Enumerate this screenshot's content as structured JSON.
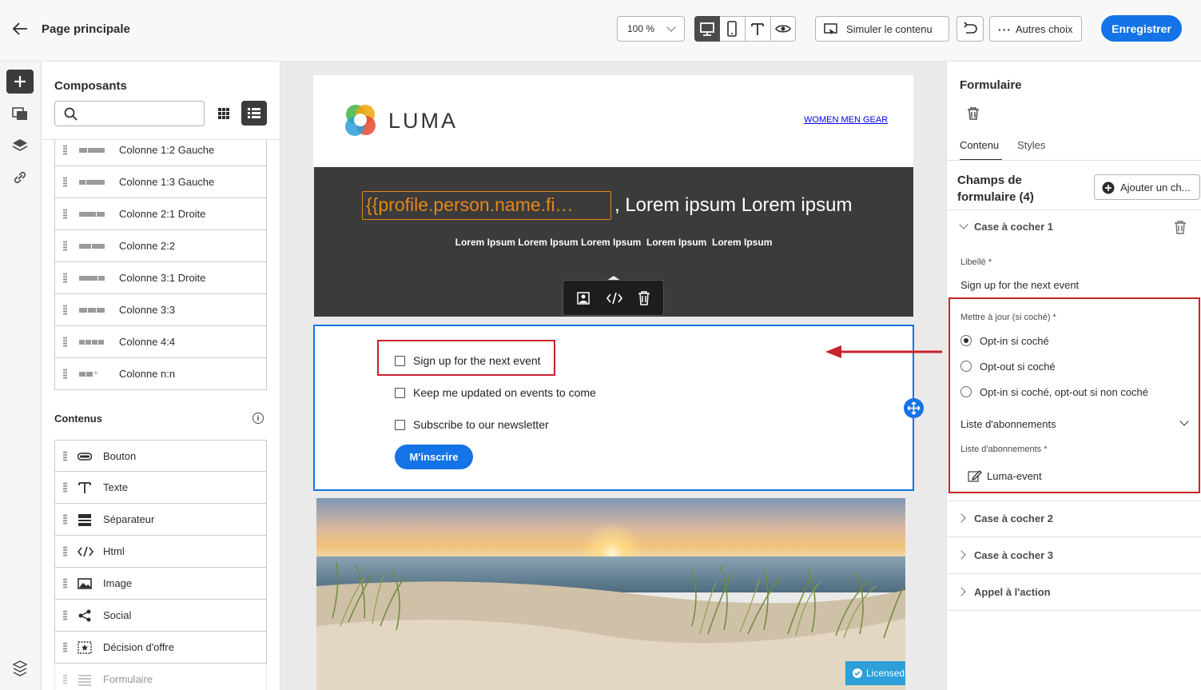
{
  "header": {
    "page_title": "Page principale",
    "zoom": "100 %",
    "simulate_label": "Simuler le contenu",
    "more_label": "Autres choix",
    "save_label": "Enregistrer"
  },
  "left_panel": {
    "title": "Composants",
    "search_placeholder": "",
    "structures": [
      {
        "label": "Colonne 1:2 Gauche",
        "icon": "columns-1-2-left-icon"
      },
      {
        "label": "Colonne 1:3 Gauche",
        "icon": "columns-1-3-left-icon"
      },
      {
        "label": "Colonne 2:1 Droite",
        "icon": "columns-2-1-right-icon"
      },
      {
        "label": "Colonne 2:2",
        "icon": "columns-2-2-icon"
      },
      {
        "label": "Colonne 3:1 Droite",
        "icon": "columns-3-1-right-icon"
      },
      {
        "label": "Colonne 3:3",
        "icon": "columns-3-3-icon"
      },
      {
        "label": "Colonne 4:4",
        "icon": "columns-4-4-icon"
      },
      {
        "label": "Colonne n:n",
        "icon": "columns-n-n-icon"
      }
    ],
    "contents_title": "Contenus",
    "contents": [
      {
        "label": "Bouton",
        "icon": "button-icon"
      },
      {
        "label": "Texte",
        "icon": "text-icon"
      },
      {
        "label": "Séparateur",
        "icon": "divider-icon"
      },
      {
        "label": "Html",
        "icon": "code-icon"
      },
      {
        "label": "Image",
        "icon": "image-icon"
      },
      {
        "label": "Social",
        "icon": "share-icon"
      },
      {
        "label": "Décision d'offre",
        "icon": "offer-decision-icon"
      },
      {
        "label": "Formulaire",
        "icon": "form-icon"
      }
    ]
  },
  "canvas": {
    "brand": "LUMA",
    "nav": [
      "WOMEN",
      "MEN",
      "GEAR"
    ],
    "personalization_token": "{{profile.person.name.fi…",
    "headline_rest": ", Lorem ipsum Lorem ipsum",
    "subline": "Lorem Ipsum Lorem Ipsum Lorem Ipsum  Lorem Ipsum  Lorem Ipsum",
    "checkboxes": [
      "Sign up for the next event",
      "Keep me updated on events to come",
      "Subscribe to our newsletter"
    ],
    "submit_label": "M'inscrire",
    "licensed_label": "Licensed"
  },
  "right_panel": {
    "title": "Formulaire",
    "tabs": [
      "Contenu",
      "Styles"
    ],
    "fields_title_line1": "Champs de",
    "fields_title_line2": "formulaire (4)",
    "add_field_label": "Ajouter un ch...",
    "checkbox1_title": "Case à cocher 1",
    "label_caption": "Libellé",
    "label_value": "Sign up for the next event",
    "update_caption": "Mettre à jour (si coché)",
    "update_options": [
      "Opt-in si coché",
      "Opt-out si coché",
      "Opt-in si coché, opt-out si non coché"
    ],
    "selected_option": "Opt-in si coché",
    "subscription_section": "Liste d'abonnements",
    "subscription_caption": "Liste d'abonnements",
    "subscription_value": "Luma-event",
    "collapsed": [
      "Case à cocher 2",
      "Case à cocher 3",
      "Appel à l'action"
    ],
    "required_mark": "*"
  },
  "colors": {
    "accent": "#1473e6",
    "highlight": "#c8232c",
    "token": "#e68619",
    "hero_bg": "#3b3b3b"
  }
}
